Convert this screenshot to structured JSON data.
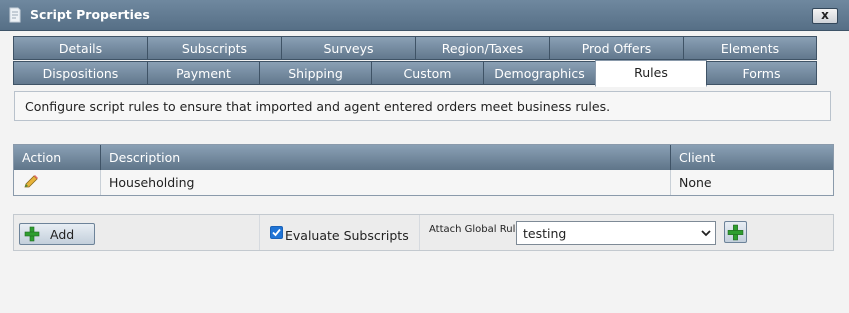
{
  "window": {
    "title": "Script Properties",
    "close_label": "x"
  },
  "tabs": {
    "row1": [
      "Details",
      "Subscripts",
      "Surveys",
      "Region/Taxes",
      "Prod Offers",
      "Elements"
    ],
    "row2": [
      "Dispositions",
      "Payment",
      "Shipping",
      "Custom",
      "Demographics",
      "Rules",
      "Forms"
    ],
    "active": "Rules"
  },
  "description": "Configure script rules to ensure that imported and agent entered orders meet business rules.",
  "grid": {
    "columns": [
      "Action",
      "Description",
      "Client"
    ],
    "rows": [
      {
        "action_icon": "pencil-icon",
        "description": "Householding",
        "client": "None"
      }
    ]
  },
  "footer": {
    "add_label": "Add",
    "evaluate_label": "Evaluate Subscripts",
    "evaluate_checked": true,
    "attach_label": "Attach Global Rule",
    "attach_value": "testing"
  },
  "colors": {
    "header_gradient_top": "#8aa0b5",
    "header_gradient_bottom": "#5f7589",
    "accent_green": "#2f9e2f"
  }
}
